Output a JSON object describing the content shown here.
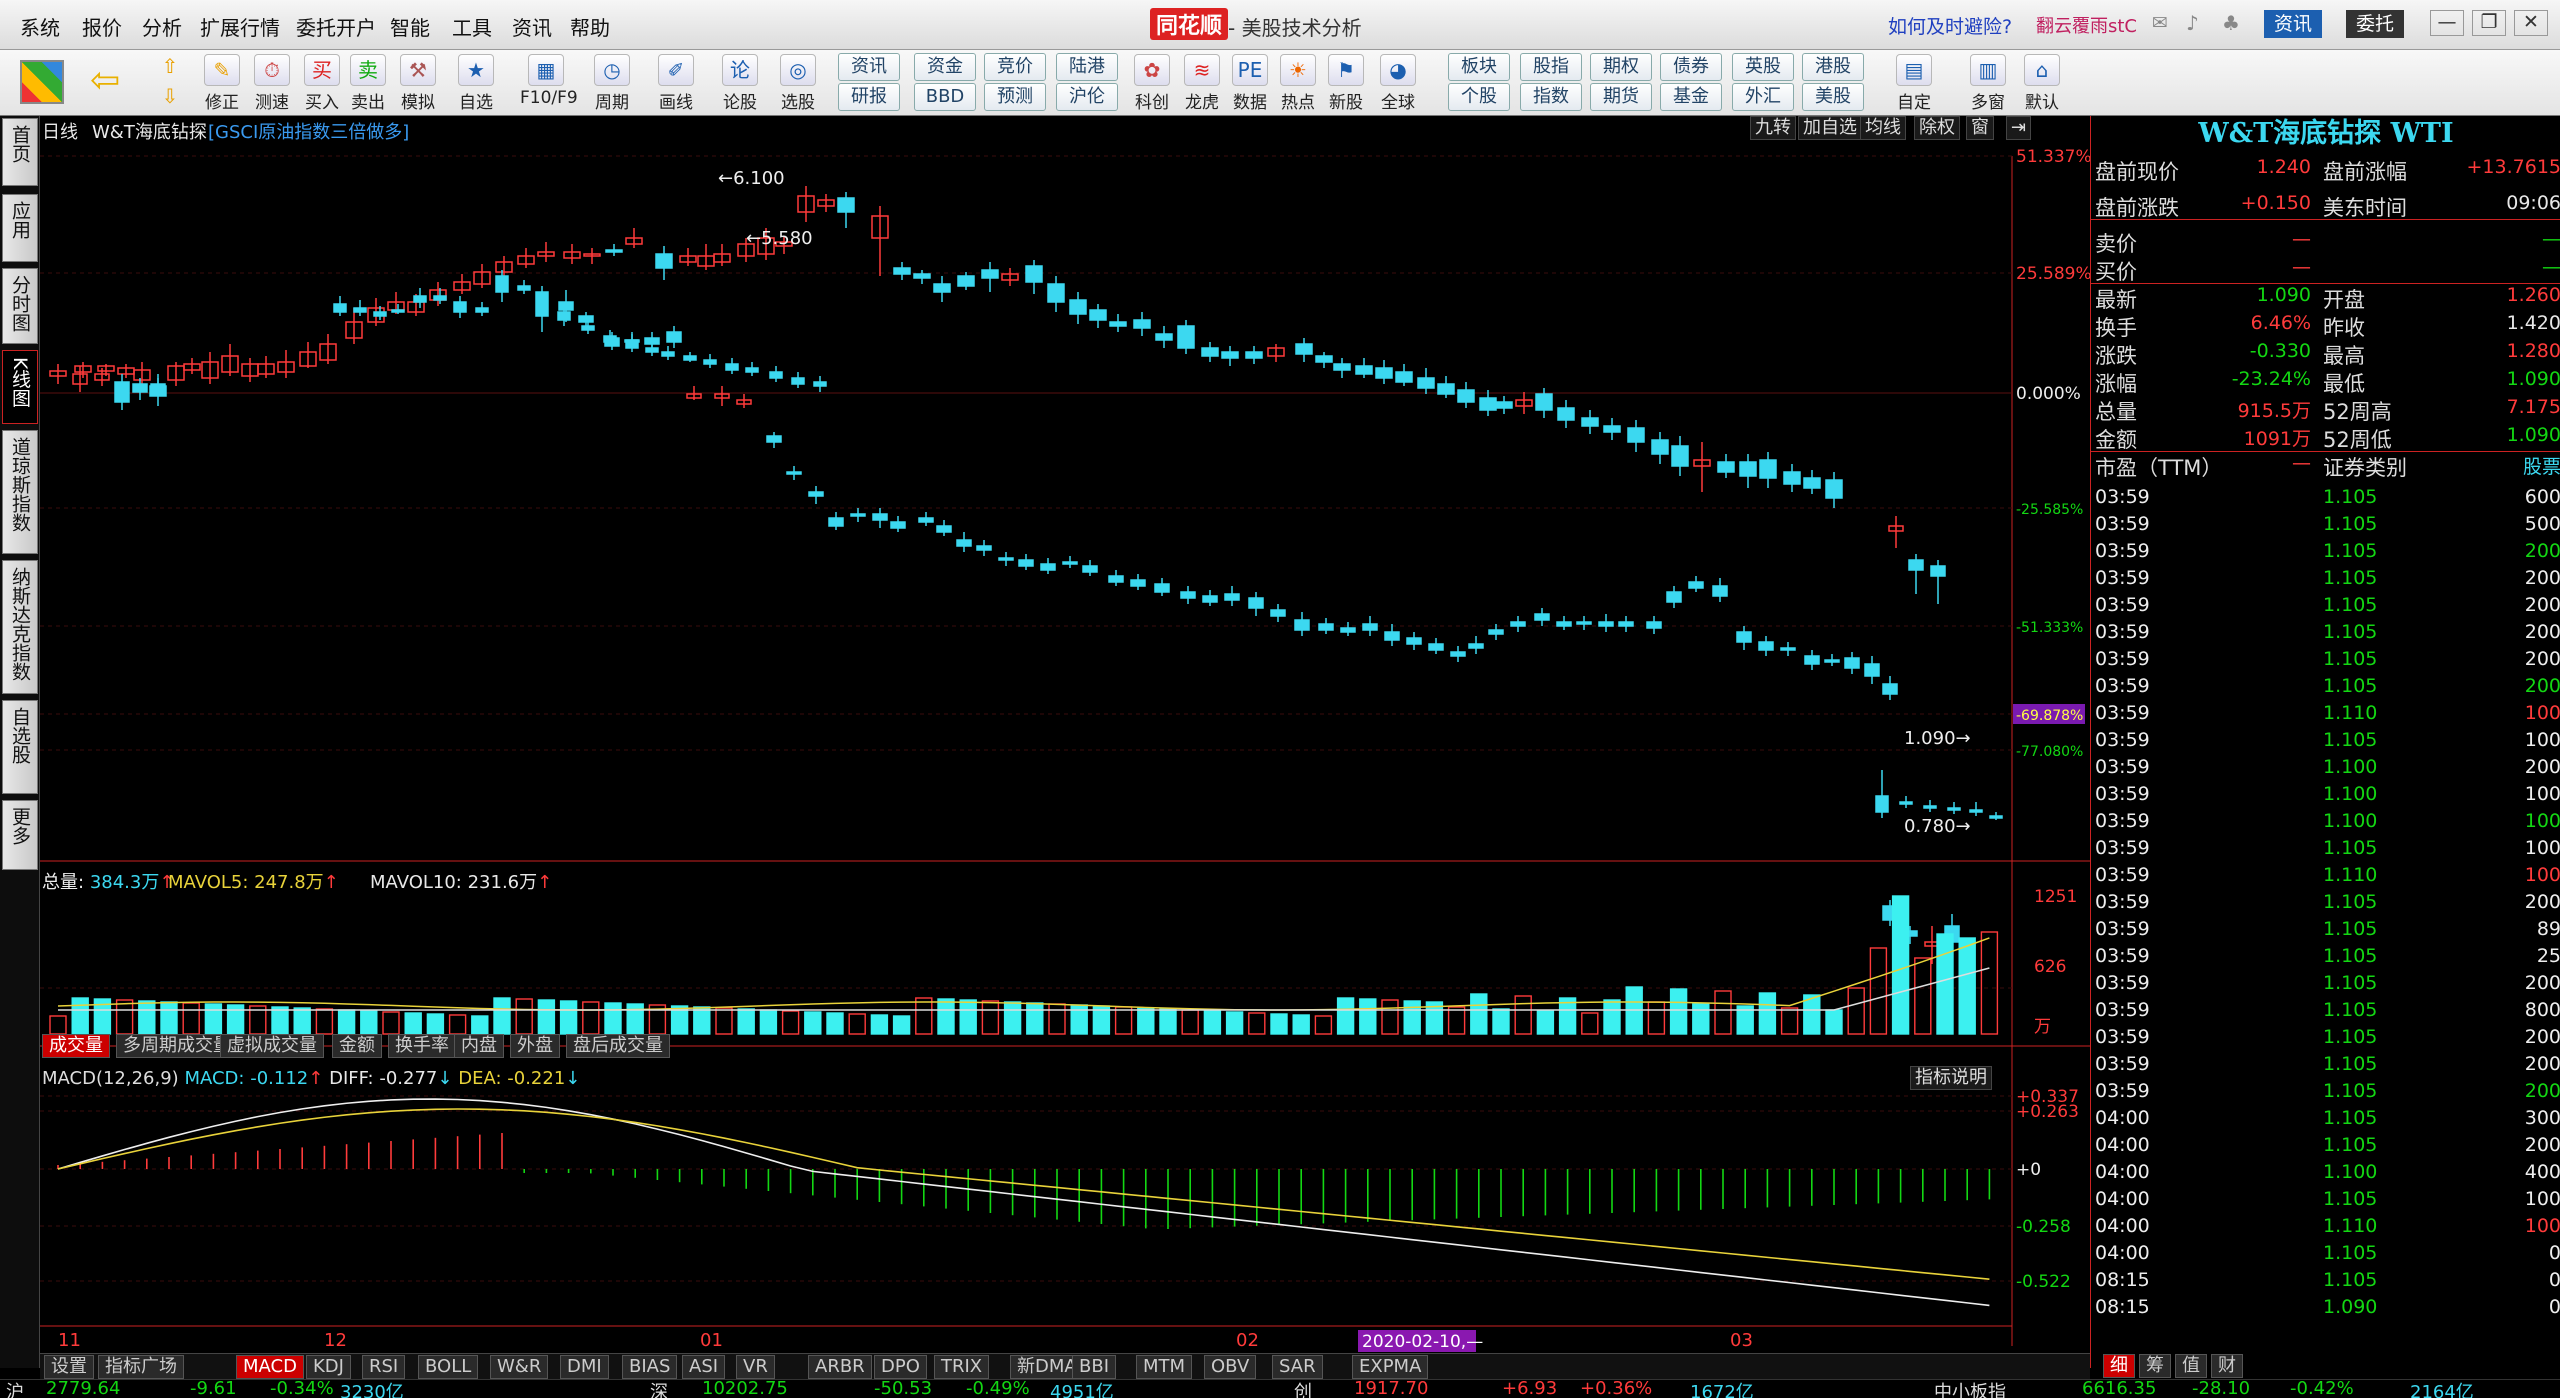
{
  "app": {
    "logo": "同花顺",
    "title": "- 美股技术分析"
  },
  "menu": [
    "系统",
    "报价",
    "分析",
    "扩展行情",
    "委托开户",
    "智能",
    "工具",
    "资讯",
    "帮助"
  ],
  "menu_right": {
    "ad": "如何及时避险?",
    "user": "翻云覆雨stC",
    "btn_news": "资讯",
    "btn_trade": "委托"
  },
  "toolbar": {
    "buttons": [
      "修正",
      "测速",
      "买入",
      "卖出",
      "模拟",
      "自选",
      "F10/F9",
      "周期",
      "画线",
      "论股",
      "选股"
    ],
    "quick_top": [
      "资讯",
      "资金",
      "竞价",
      "陆港"
    ],
    "quick_bot": [
      "研报",
      "BBD",
      "预测",
      "沪伦"
    ],
    "icons2": [
      "科创",
      "龙虎",
      "数据",
      "热点",
      "新股",
      "全球"
    ],
    "quick2_top": [
      "板块",
      "股指",
      "期权",
      "债券",
      "英股",
      "港股"
    ],
    "quick2_bot": [
      "个股",
      "指数",
      "期货",
      "基金",
      "外汇",
      "美股"
    ],
    "right": [
      "自定",
      "多窗",
      "默认"
    ]
  },
  "sidebar": [
    "首页",
    "应用",
    "分时图",
    "K线图",
    "道琼斯指数",
    "纳斯达克指数",
    "自选股",
    "更多"
  ],
  "chart": {
    "period": "日线",
    "name": "W&T海底钻探",
    "tag": "[GSCI原油指数三倍做多]",
    "top_buttons": [
      "九转",
      "加自选",
      "均线",
      "除权",
      "窗"
    ],
    "high_label": "6.100",
    "high2_label": "5.580",
    "last_label": "1.090",
    "low_label": "0.780",
    "pct_labels": [
      "51.337%",
      "25.589%",
      "0.000%",
      "-25.585%",
      "-51.333%",
      "-69.878%",
      "-77.080%"
    ],
    "x_labels": [
      "11",
      "12",
      "01",
      "02",
      "03"
    ],
    "cursor_date": "2020-02-10,—"
  },
  "volume": {
    "total_label": "总量:",
    "total": "384.3万",
    "ma5_label": "MAVOL5:",
    "ma5": "247.8万",
    "ma10_label": "MAVOL10:",
    "ma10": "231.6万",
    "axis": [
      "1251",
      "626",
      "万"
    ],
    "tabs": [
      "成交量",
      "多周期成交量",
      "虚拟成交量",
      "金额",
      "换手率",
      "内盘",
      "外盘",
      "盘后成交量"
    ]
  },
  "macd": {
    "title": "MACD(12,26,9)",
    "macd_label": "MACD:",
    "macd": "-0.112",
    "diff_label": "DIFF:",
    "diff": "-0.277",
    "dea_label": "DEA:",
    "dea": "-0.221",
    "help": "指标说明",
    "axis": [
      "+0.337",
      "+0.263",
      "+0",
      "-0.258",
      "-0.522"
    ]
  },
  "indicator_tabs": [
    "设置",
    "指标广场",
    "MACD",
    "KDJ",
    "RSI",
    "BOLL",
    "W&R",
    "DMI",
    "BIAS",
    "ASI",
    "VR",
    "ARBR",
    "DPO",
    "TRIX",
    "新DMA",
    "BBI",
    "MTM",
    "OBV",
    "SAR",
    "EXPMA"
  ],
  "quote": {
    "title": "W&T海底钻探 WTI",
    "rows": [
      {
        "l1": "盘前现价",
        "v1": "1.240",
        "l2": "盘前涨幅",
        "v2": "+13.7615"
      },
      {
        "l1": "盘前涨跌",
        "v1": "+0.150",
        "l2": "美东时间",
        "v2": "09:06"
      },
      {
        "l1": "卖价",
        "v1": "—",
        "l2": "",
        "v2": "—"
      },
      {
        "l1": "买价",
        "v1": "—",
        "l2": "",
        "v2": "—"
      },
      {
        "l1": "最新",
        "v1": "1.090",
        "l2": "开盘",
        "v2": "1.260"
      },
      {
        "l1": "换手",
        "v1": "6.46%",
        "l2": "昨收",
        "v2": "1.420"
      },
      {
        "l1": "涨跌",
        "v1": "-0.330",
        "l2": "最高",
        "v2": "1.280"
      },
      {
        "l1": "涨幅",
        "v1": "-23.24%",
        "l2": "最低",
        "v2": "1.090"
      },
      {
        "l1": "总量",
        "v1": "915.5万",
        "l2": "52周高",
        "v2": "7.175"
      },
      {
        "l1": "金额",
        "v1": "1091万",
        "l2": "52周低",
        "v2": "1.090"
      },
      {
        "l1": "市盈（TTM）",
        "v1": "—",
        "l2": "证券类别",
        "v2": "股票"
      }
    ],
    "ticks": [
      [
        "03:59",
        "1.105",
        "600"
      ],
      [
        "03:59",
        "1.105",
        "500"
      ],
      [
        "03:59",
        "1.105",
        "200"
      ],
      [
        "03:59",
        "1.105",
        "200"
      ],
      [
        "03:59",
        "1.105",
        "200"
      ],
      [
        "03:59",
        "1.105",
        "200"
      ],
      [
        "03:59",
        "1.105",
        "200"
      ],
      [
        "03:59",
        "1.105",
        "200"
      ],
      [
        "03:59",
        "1.110",
        "100"
      ],
      [
        "03:59",
        "1.105",
        "100"
      ],
      [
        "03:59",
        "1.100",
        "200"
      ],
      [
        "03:59",
        "1.100",
        "100"
      ],
      [
        "03:59",
        "1.100",
        "100"
      ],
      [
        "03:59",
        "1.105",
        "100"
      ],
      [
        "03:59",
        "1.110",
        "100"
      ],
      [
        "03:59",
        "1.105",
        "200"
      ],
      [
        "03:59",
        "1.105",
        "89"
      ],
      [
        "03:59",
        "1.105",
        "25"
      ],
      [
        "03:59",
        "1.105",
        "200"
      ],
      [
        "03:59",
        "1.105",
        "800"
      ],
      [
        "03:59",
        "1.105",
        "200"
      ],
      [
        "03:59",
        "1.105",
        "200"
      ],
      [
        "03:59",
        "1.105",
        "200"
      ],
      [
        "04:00",
        "1.105",
        "300"
      ],
      [
        "04:00",
        "1.105",
        "200"
      ],
      [
        "04:00",
        "1.100",
        "400"
      ],
      [
        "04:00",
        "1.105",
        "100"
      ],
      [
        "04:00",
        "1.110",
        "100"
      ],
      [
        "04:00",
        "1.105",
        "0"
      ],
      [
        "08:15",
        "1.105",
        "0"
      ],
      [
        "08:15",
        "1.090",
        "0"
      ]
    ],
    "bottom_tabs": [
      "细",
      "筹",
      "值",
      "财"
    ]
  },
  "status": [
    {
      "k": "沪",
      "v": "2779.64",
      "c": "-9.61",
      "p": "-0.34%",
      "a": "3230亿"
    },
    {
      "k": "深",
      "v": "10202.75",
      "c": "-50.53",
      "p": "-0.49%",
      "a": "4951亿"
    },
    {
      "k": "创",
      "v": "1917.70",
      "c": "+6.93",
      "p": "+0.36%",
      "a": "1672亿"
    },
    {
      "k": "中小板指",
      "v": "6616.35",
      "c": "-28.10",
      "p": "-0.42%",
      "a": "2164亿"
    }
  ],
  "chart_data": {
    "type": "candlestick",
    "y_pct_range": [
      -77.08,
      51.337
    ],
    "x_months": [
      "11",
      "12",
      "01",
      "02",
      "03"
    ],
    "annotations": {
      "high": 6.1,
      "low": 0.78,
      "last": 1.09
    }
  }
}
